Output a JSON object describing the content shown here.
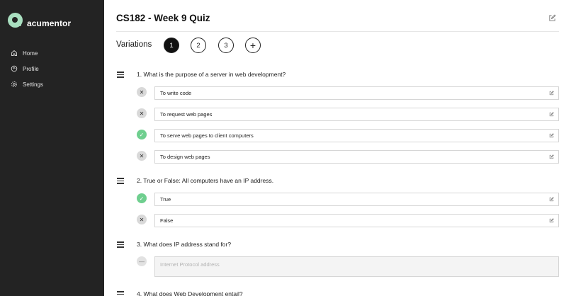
{
  "app": {
    "name": "acumentor"
  },
  "sidebar": {
    "items": [
      {
        "label": "Home",
        "icon": "home-icon"
      },
      {
        "label": "Profile",
        "icon": "profile-icon"
      },
      {
        "label": "Settings",
        "icon": "gear-icon"
      }
    ]
  },
  "quiz": {
    "title": "CS182 - Week 9 Quiz",
    "variations_label": "Variations",
    "variations": [
      "1",
      "2",
      "3"
    ],
    "active_variation": "1",
    "add_symbol": "+",
    "questions": [
      {
        "text": "1. What is the purpose of a server in web development?",
        "answers": [
          {
            "text": "To write code",
            "correct": false
          },
          {
            "text": "To request web pages",
            "correct": false
          },
          {
            "text": "To serve web pages to client computers",
            "correct": true
          },
          {
            "text": "To design web pages",
            "correct": false
          }
        ]
      },
      {
        "text": "2. True or False: All computers have an IP address.",
        "answers": [
          {
            "text": "True",
            "correct": true
          },
          {
            "text": "False",
            "correct": false
          }
        ]
      },
      {
        "text": "3. What does IP address stand for?",
        "answers": [
          {
            "placeholder": "Internet Protocol address"
          }
        ]
      },
      {
        "text": "4. What does Web Development entail?"
      }
    ]
  },
  "colors": {
    "sidebar_bg": "#232323",
    "brand": "#a9dfc0",
    "correct": "#6fcf8f",
    "wrong": "#d9d9d9"
  }
}
